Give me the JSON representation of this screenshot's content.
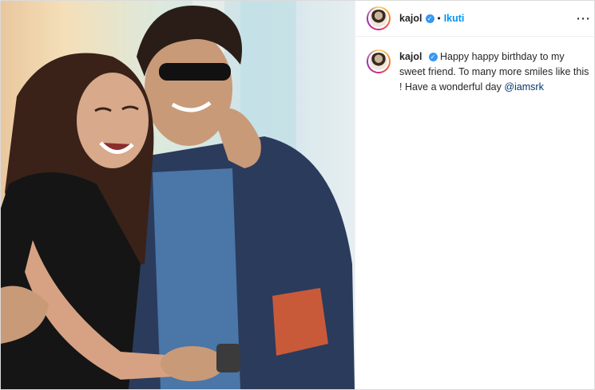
{
  "post": {
    "username": "kajol",
    "verified_glyph": "✓",
    "separator": "•",
    "follow_label": "Ikuti",
    "more_glyph": "⋯",
    "caption": {
      "username": "kajol",
      "text": "Happy happy birthday to my sweet friend. To many more smiles like this ! Have a wonderful day ",
      "mention": "@iamsrk"
    },
    "image_description_icon": "photo-of-two-people-icon"
  },
  "colors": {
    "link": "#0095f6",
    "verified": "#3897f0",
    "text": "#262626"
  }
}
